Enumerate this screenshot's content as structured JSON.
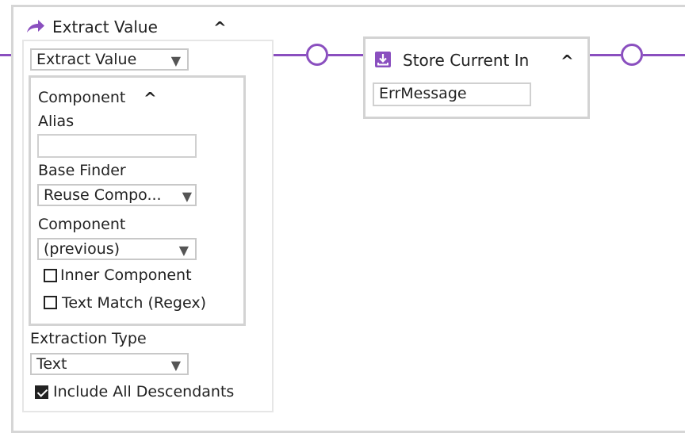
{
  "extract_step": {
    "title": "Extract Value",
    "type_select": "Extract Value",
    "component": {
      "header": "Component",
      "alias_label": "Alias",
      "alias_value": "",
      "base_finder_label": "Base Finder",
      "base_finder_value": "Reuse Compo...",
      "component_label": "Component",
      "component_value": "(previous)",
      "inner_component_label": "Inner Component",
      "inner_component_checked": false,
      "text_match_label": "Text Match (Regex)",
      "text_match_checked": false
    },
    "extraction_type_label": "Extraction Type",
    "extraction_type_value": "Text",
    "include_descendants_label": "Include All Descendants",
    "include_descendants_checked": true
  },
  "store_step": {
    "title": "Store Current In",
    "value": "ErrMessage"
  },
  "colors": {
    "accent": "#8a4fbf",
    "border": "#d3d3d3"
  }
}
